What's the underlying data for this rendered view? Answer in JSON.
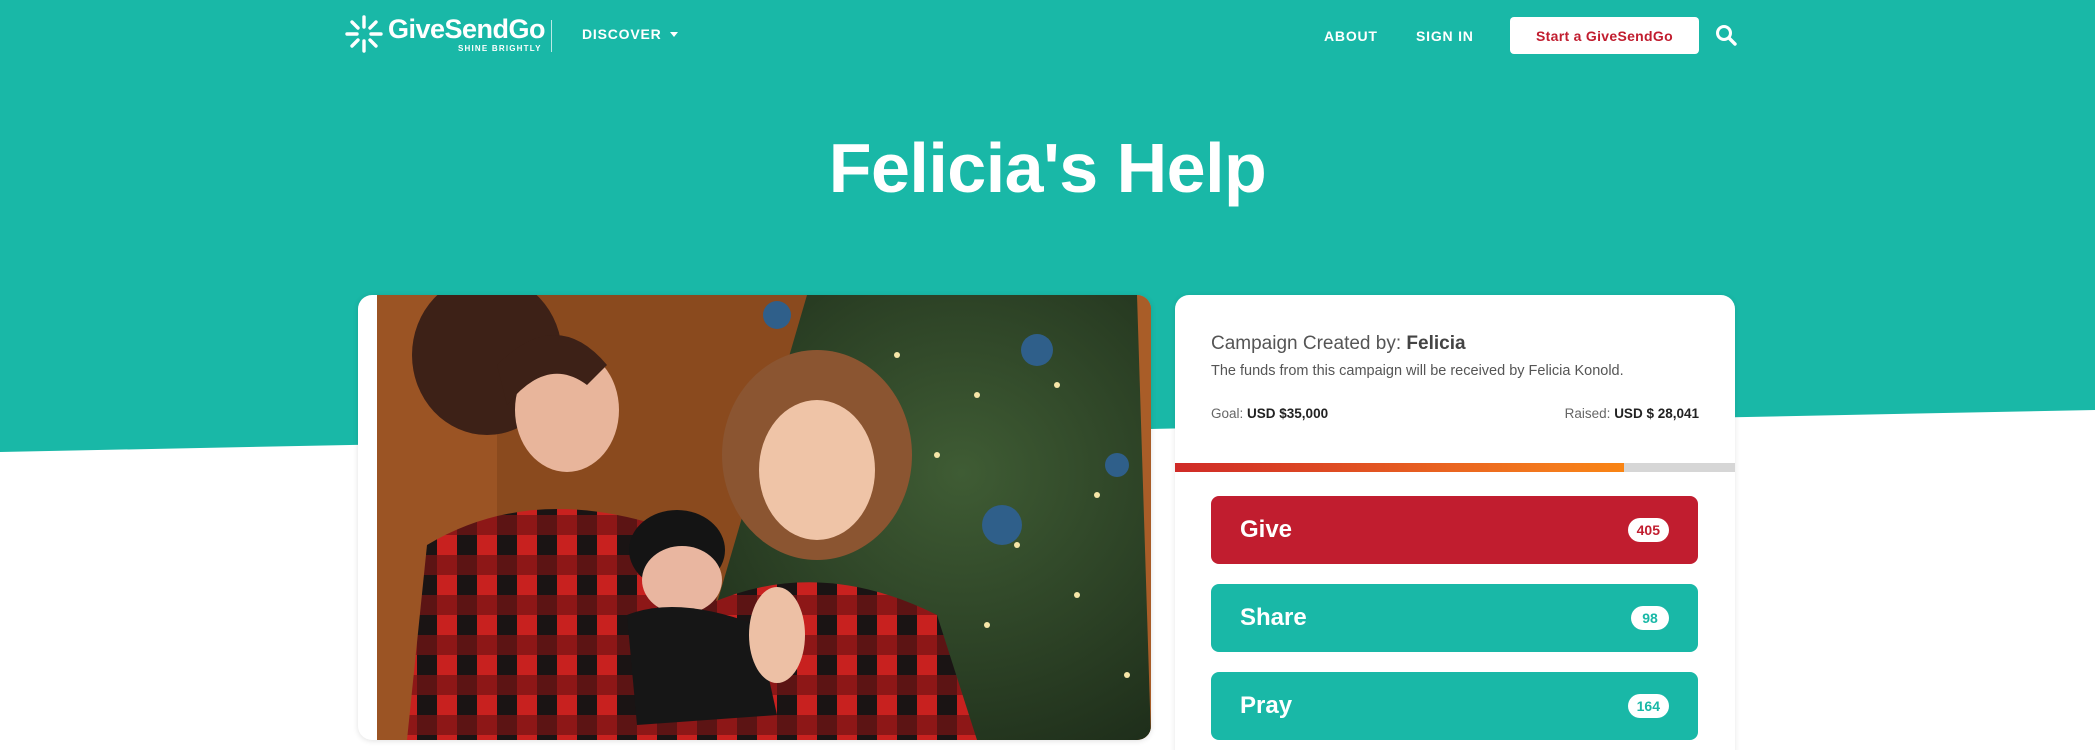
{
  "header": {
    "logo_name": "GiveSendGo",
    "logo_tagline": "SHINE BRIGHTLY",
    "discover_label": "DISCOVER",
    "about_label": "ABOUT",
    "signin_label": "SIGN IN",
    "start_label": "Start a GiveSendGo"
  },
  "campaign": {
    "title": "Felicia's Help",
    "created_by_prefix": "Campaign Created by: ",
    "creator": "Felicia",
    "funds_note": "The funds from this campaign will be received by Felicia Konold.",
    "goal_prefix": "Goal: ",
    "goal_value": "USD $35,000",
    "raised_prefix": "Raised: ",
    "raised_value": "USD $ 28,041",
    "progress_fraction": 0.801
  },
  "actions": {
    "give_label": "Give",
    "give_count": "405",
    "share_label": "Share",
    "share_count": "98",
    "pray_label": "Pray",
    "pray_count": "164"
  },
  "colors": {
    "brand_teal": "#19b8a7",
    "give_red": "#c11d2f",
    "progress_orange": "#f47b1d"
  },
  "icons": {
    "logo": "sunburst-logo-icon",
    "discover_caret": "caret-down-icon",
    "search": "search-icon"
  }
}
